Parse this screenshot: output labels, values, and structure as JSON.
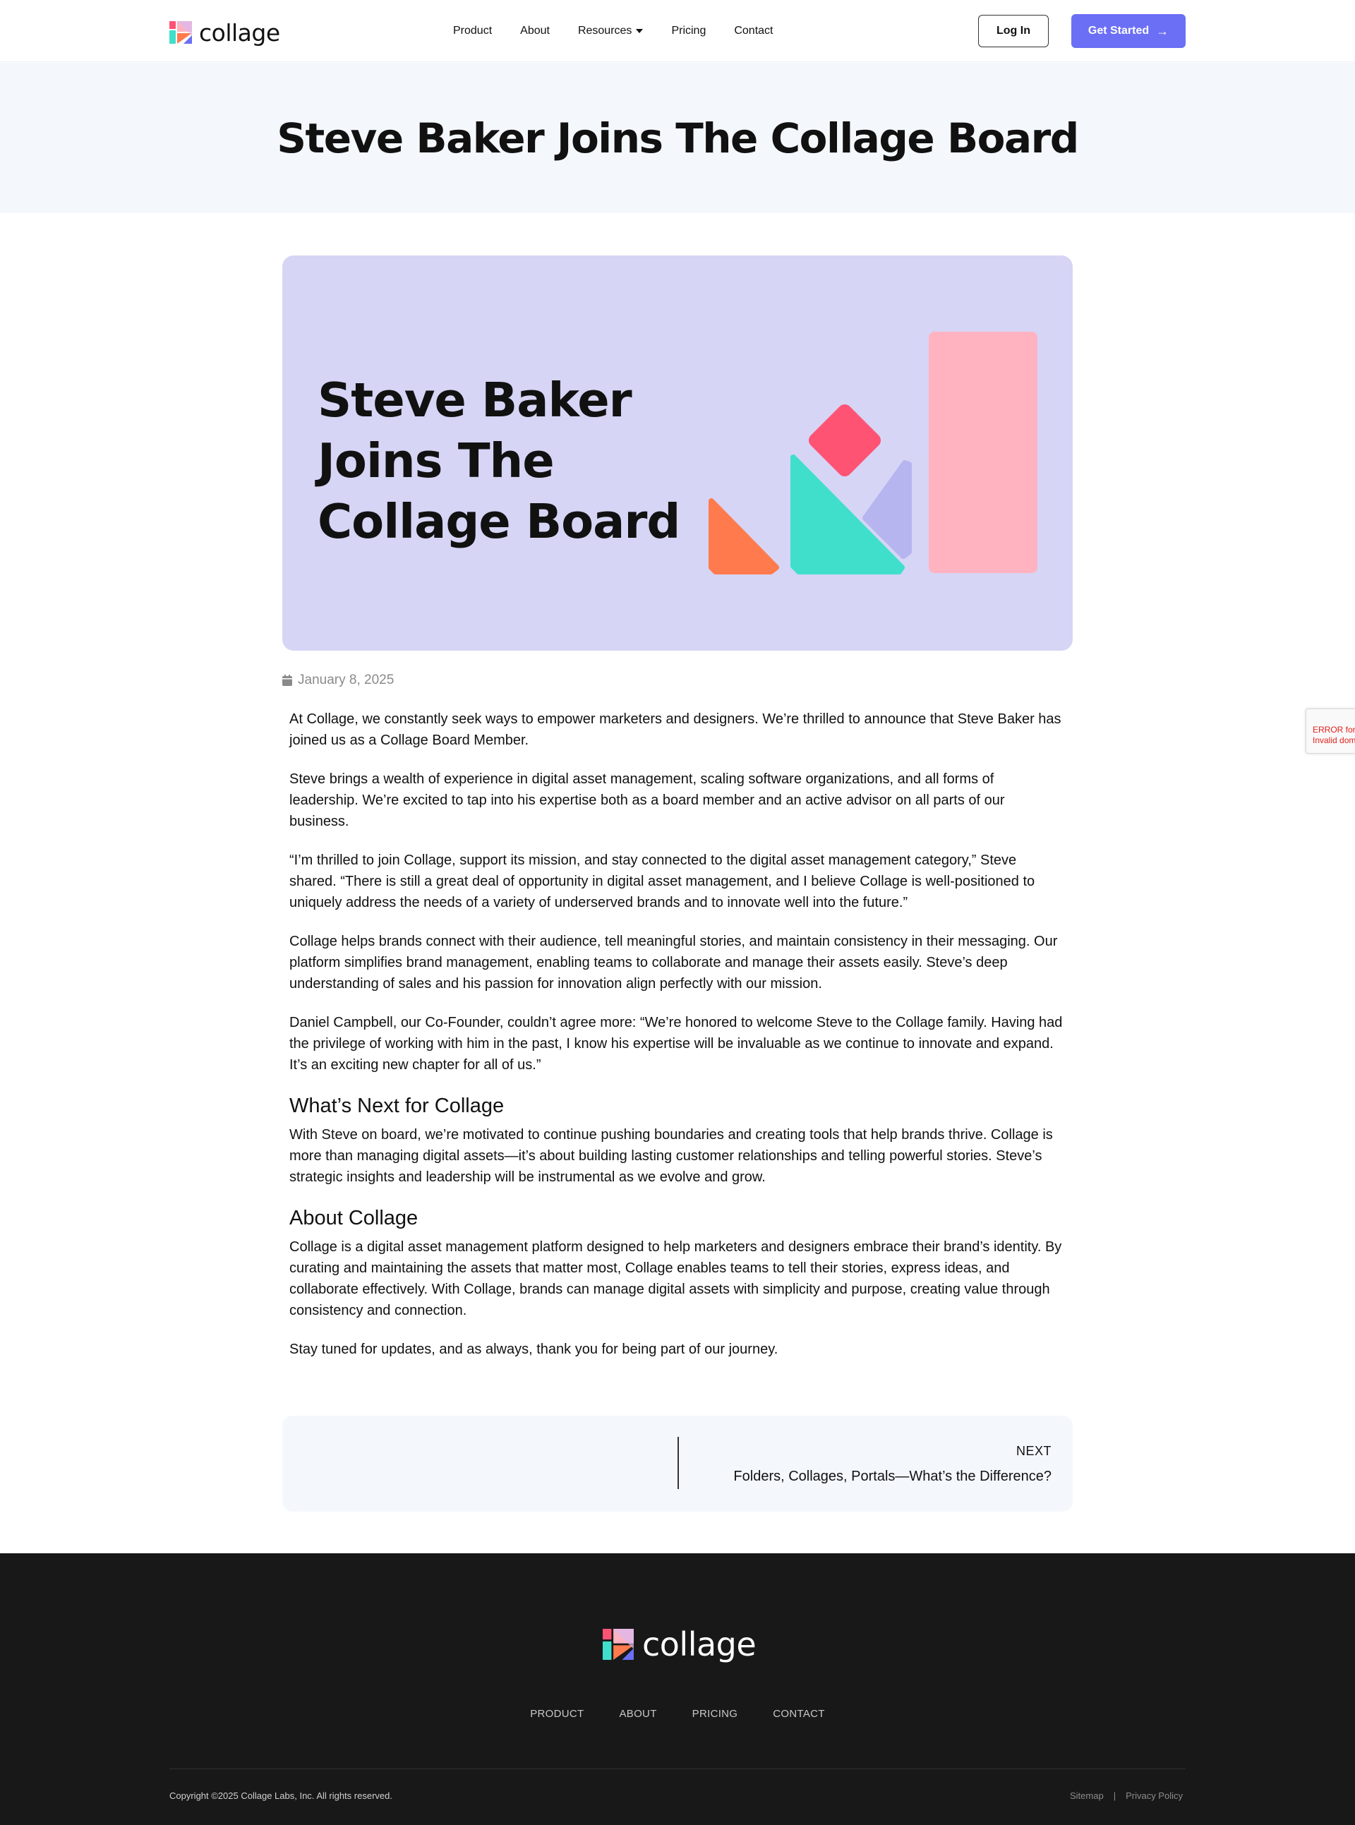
{
  "header": {
    "logo_text": "collage",
    "nav": [
      {
        "label": "Product"
      },
      {
        "label": "About"
      },
      {
        "label": "Resources",
        "has_dropdown": true
      },
      {
        "label": "Pricing"
      },
      {
        "label": "Contact"
      }
    ],
    "login_label": "Log In",
    "get_started_label": "Get Started"
  },
  "hero": {
    "title": "Steve Baker Joins The Collage Board"
  },
  "feature_image": {
    "title_lines": [
      "Steve Baker",
      "Joins The",
      "Collage Board"
    ],
    "colors": {
      "background": "#d6d5f5",
      "orange": "#ff7b4d",
      "teal": "#40dfcc",
      "pink_diamond": "#ff5374",
      "lavender": "#b6b5f0",
      "pink_bar": "#ffb3c1"
    }
  },
  "post": {
    "date": "January 8, 2025",
    "paragraphs": [
      "At Collage, we constantly seek ways to empower marketers and designers. We’re thrilled to announce that Steve Baker has joined us as a Collage Board Member.",
      "Steve brings a wealth of experience in digital asset management, scaling software organizations, and all forms of leadership. We’re excited to tap into his expertise both as a board member and an active advisor on all parts of our business.",
      "“I’m thrilled to join Collage, support its mission, and stay connected to the digital asset management category,” Steve shared. “There is still a great deal of opportunity in digital asset management, and I believe Collage is well-positioned to uniquely address the needs of a variety of underserved brands and to innovate well into the future.”",
      "Collage helps brands connect with their audience, tell meaningful stories, and maintain consistency in their messaging. Our platform simplifies brand management, enabling teams to collaborate and manage their assets easily. Steve’s deep understanding of sales and his passion for innovation align perfectly with our mission.",
      "Daniel Campbell, our Co-Founder, couldn’t agree more: “We’re honored to welcome Steve to the Collage family. Having had the privilege of working with him in the past, I know his expertise will be invaluable as we continue to innovate and expand. It’s an exciting new chapter for all of us.”"
    ],
    "section_next": {
      "heading": "What’s Next for Collage",
      "paragraph": "With Steve on board, we’re motivated to continue pushing boundaries and creating tools that help brands thrive. Collage is more than managing digital assets—it’s about building lasting customer relationships and telling powerful stories. Steve’s strategic insights and leadership will be instrumental as we evolve and grow."
    },
    "section_about": {
      "heading": "About Collage",
      "paragraph": "Collage is a digital asset management platform designed to help marketers and designers embrace their brand’s identity. By curating and maintaining the assets that matter most, Collage enables teams to tell their stories, express ideas, and collaborate effectively. With Collage, brands can manage digital assets with simplicity and purpose, creating value through consistency and connection.",
      "closing": "Stay tuned for updates, and as always, thank you for being part of our journey."
    }
  },
  "next_post": {
    "label": "NEXT",
    "title": "Folders, Collages, Portals—What’s the Difference?"
  },
  "footer": {
    "logo_text": "collage",
    "nav": [
      {
        "label": "PRODUCT"
      },
      {
        "label": "ABOUT"
      },
      {
        "label": "PRICING"
      },
      {
        "label": "CONTACT"
      }
    ],
    "copyright": "Copyright ©2025 Collage Labs, Inc. All rights reserved.",
    "sitemap": "Sitemap",
    "separator": "|",
    "privacy": "Privacy Policy"
  },
  "recaptcha": {
    "line1": "ERROR for site owner:",
    "line2": "Invalid domain for site key"
  },
  "theme": {
    "accent": "#6b6ff5",
    "hero_band": "#f4f8fd",
    "footer_bg": "#181818"
  }
}
